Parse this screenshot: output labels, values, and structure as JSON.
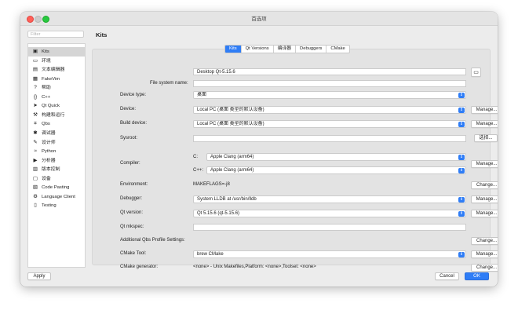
{
  "window": {
    "title": "首选项"
  },
  "filter": {
    "placeholder": "Filter"
  },
  "sidebar": {
    "items": [
      {
        "label": "Kits",
        "icon": "kits-icon",
        "glyph": "▣",
        "selected": true
      },
      {
        "label": "环境",
        "icon": "monitor-icon",
        "glyph": "▭"
      },
      {
        "label": "文本编辑器",
        "icon": "text-editor-icon",
        "glyph": "▤"
      },
      {
        "label": "FakeVim",
        "icon": "fakevim-icon",
        "glyph": "▦"
      },
      {
        "label": "帮助",
        "icon": "help-icon",
        "glyph": "?"
      },
      {
        "label": "C++",
        "icon": "cpp-icon",
        "glyph": "{}"
      },
      {
        "label": "Qt Quick",
        "icon": "qt-quick-icon",
        "glyph": "➤"
      },
      {
        "label": "构建和运行",
        "icon": "build-run-icon",
        "glyph": "⚒"
      },
      {
        "label": "Qbs",
        "icon": "qbs-icon",
        "glyph": "⌗"
      },
      {
        "label": "调试器",
        "icon": "debugger-icon",
        "glyph": "✱"
      },
      {
        "label": "设计师",
        "icon": "designer-icon",
        "glyph": "✎"
      },
      {
        "label": "Python",
        "icon": "python-icon",
        "glyph": "≈"
      },
      {
        "label": "分析器",
        "icon": "analyzer-icon",
        "glyph": "▶"
      },
      {
        "label": "版本控制",
        "icon": "version-control-icon",
        "glyph": "▥"
      },
      {
        "label": "设备",
        "icon": "devices-icon",
        "glyph": "▢"
      },
      {
        "label": "Code Pasting",
        "icon": "code-pasting-icon",
        "glyph": "▧"
      },
      {
        "label": "Language Client",
        "icon": "language-client-icon",
        "glyph": "⚙"
      },
      {
        "label": "Testing",
        "icon": "testing-icon",
        "glyph": "▯"
      }
    ]
  },
  "page_title": "Kits",
  "tabs": [
    {
      "label": "Kits",
      "selected": true
    },
    {
      "label": "Qt Versions"
    },
    {
      "label": "编译器"
    },
    {
      "label": "Debuggers"
    },
    {
      "label": "CMake"
    }
  ],
  "form": {
    "name_value": "Desktop Qt-5.15.6",
    "fs_label": "File system name:",
    "fs_value": "",
    "device_type_label": "Device type:",
    "device_type_value": "桌面",
    "device_label": "Device:",
    "device_value": "Local PC (桌面 类型的默认设备)",
    "build_device_label": "Build device:",
    "build_device_value": "Local PC (桌面 类型的默认设备)",
    "sysroot_label": "Sysroot:",
    "sysroot_value": "",
    "compiler_label": "Compiler:",
    "compiler_c_label": "C:",
    "compiler_c_value": "Apple Clang (arm64)",
    "compiler_cpp_label": "C++:",
    "compiler_cpp_value": "Apple Clang (arm64)",
    "environment_label": "Environment:",
    "environment_value": "MAKEFLAGS=-j8",
    "debugger_label": "Debugger:",
    "debugger_value": "System LLDB at /usr/bin/lldb",
    "qt_version_label": "Qt version:",
    "qt_version_value": "Qt 5.15.6 (qt-5.15.6)",
    "qt_mkspec_label": "Qt mkspec:",
    "qt_mkspec_value": "",
    "qbs_label": "Additional Qbs Profile Settings:",
    "cmake_tool_label": "CMake Tool:",
    "cmake_tool_value": "brew CMake",
    "cmake_gen_label": "CMake generator:",
    "cmake_gen_value": "<none> - Unix Makefiles,Platform: <none>,Toolset: <none>"
  },
  "buttons": {
    "manage": "Manage...",
    "browse": "选择...",
    "change": "Change...",
    "apply": "Apply",
    "cancel": "Cancel",
    "ok": "OK"
  },
  "colors": {
    "accent": "#2f7df6"
  }
}
